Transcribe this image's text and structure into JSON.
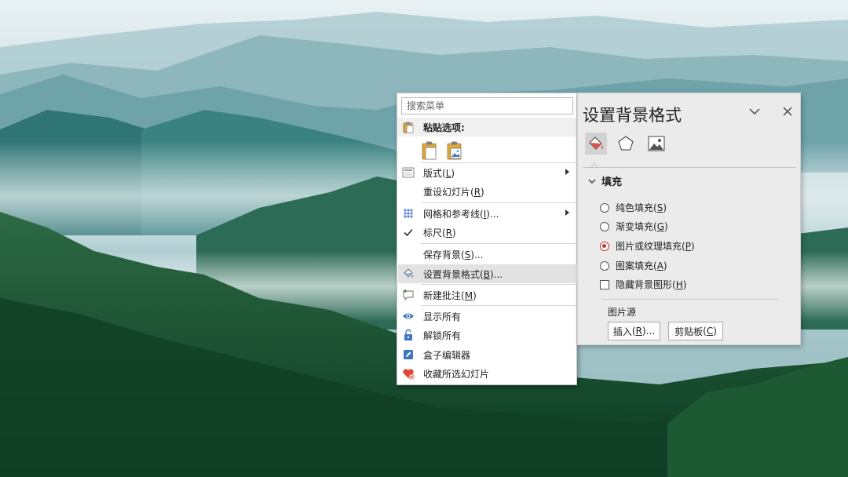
{
  "context_menu": {
    "search_placeholder": "搜索菜单",
    "paste_header": "粘贴选项:",
    "items": {
      "layout": "版式",
      "layout_key": "L",
      "reset_slide": "重设幻灯片",
      "reset_slide_key": "R",
      "grid_guides": "网格和参考线",
      "grid_guides_key": "I",
      "ruler": "标尺",
      "ruler_key": "R",
      "save_background": "保存背景",
      "save_background_key": "S",
      "format_background": "设置背景格式",
      "format_background_key": "B",
      "new_comment": "新建批注",
      "new_comment_key": "M",
      "show_all": "显示所有",
      "unlock_all": "解锁所有",
      "box_editor": "盒子编辑器",
      "favorite_slides": "收藏所选幻灯片"
    },
    "ellipsis": "...",
    "open_paren": "(",
    "close_paren": ")"
  },
  "format_pane": {
    "title": "设置背景格式",
    "fill_section": "填充",
    "options": {
      "solid": "纯色填充",
      "solid_key": "S",
      "gradient": "渐变填充",
      "gradient_key": "G",
      "picture": "图片或纹理填充",
      "picture_key": "P",
      "pattern": "图案填充",
      "pattern_key": "A",
      "hide_graphics": "隐藏背景图形",
      "hide_graphics_key": "H"
    },
    "selected_option": "picture",
    "picture_source": "图片源",
    "insert_label": "插入",
    "insert_key": "R",
    "clipboard_label": "剪贴板",
    "clipboard_key": "C"
  },
  "colors": {
    "accent_red": "#c0392b",
    "menu_hover": "#e2e2e2",
    "pane_bg": "#ebebeb"
  }
}
